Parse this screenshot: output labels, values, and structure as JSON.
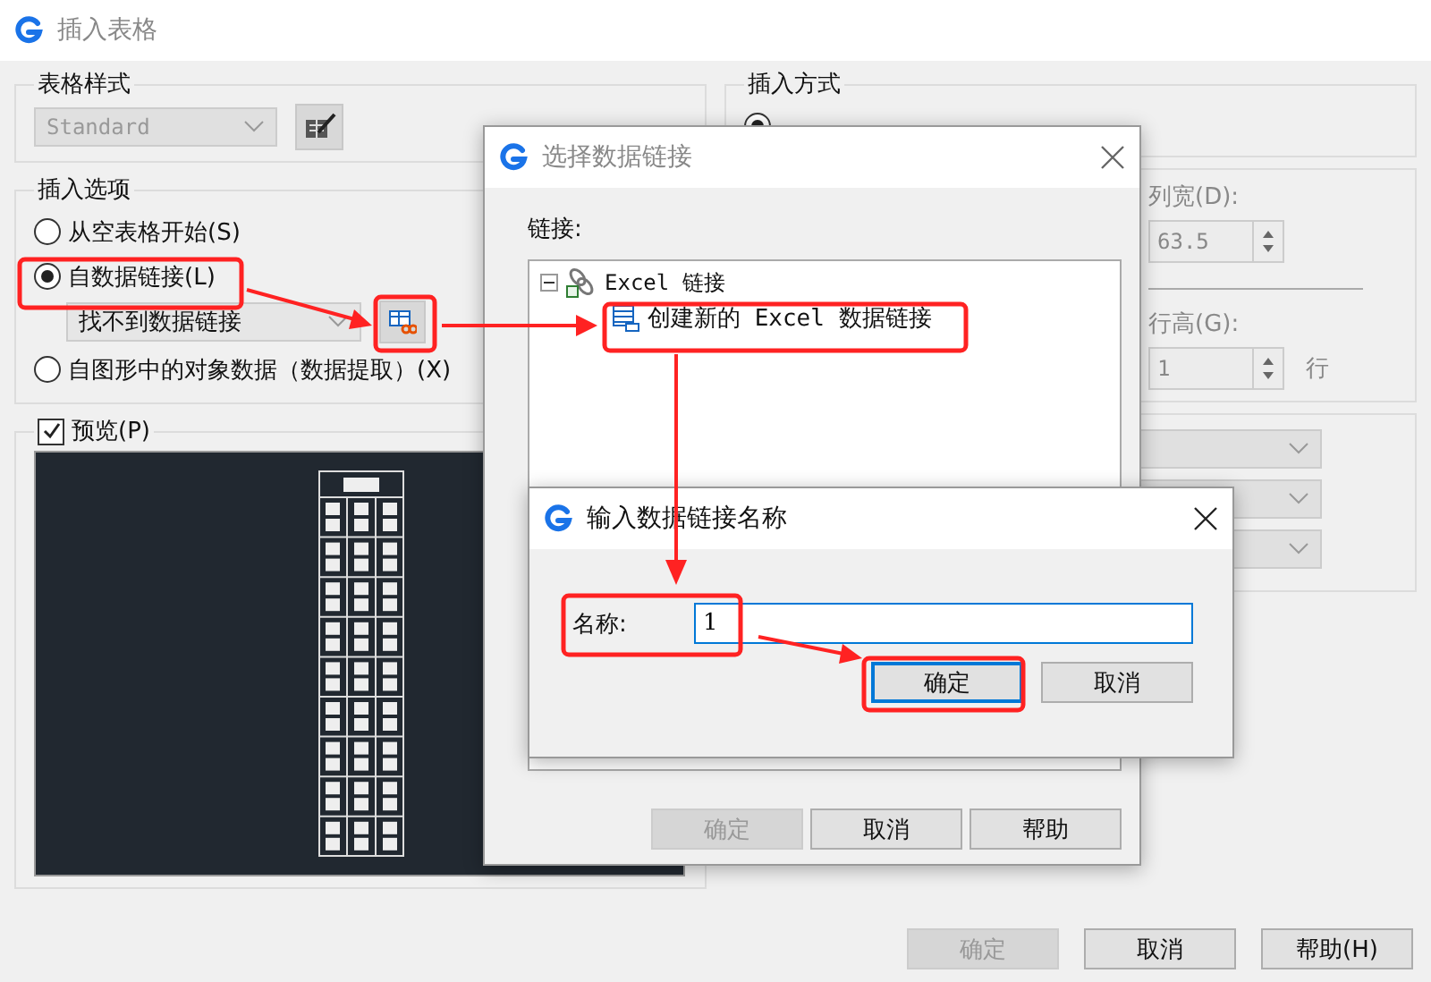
{
  "main_window": {
    "title": "插入表格",
    "table_style": {
      "label": "表格样式",
      "value": "Standard",
      "disabled": true
    },
    "insert_options": {
      "label": "插入选项",
      "options": [
        {
          "label": "从空表格开始(S)",
          "selected": false
        },
        {
          "label": "自数据链接(L)",
          "selected": true
        },
        {
          "label": "自图形中的对象数据（数据提取）(X)",
          "selected": false
        }
      ],
      "link_value": "找不到数据链接"
    },
    "preview": {
      "label": "预览(P)",
      "checked": true
    },
    "insert_method": {
      "label": "插入方式",
      "option": {
        "selected": true
      }
    },
    "column_width": {
      "label": "列宽(D):",
      "value": "63.5"
    },
    "row_height": {
      "label": "行高(G):",
      "value": "1",
      "unit": "行"
    },
    "buttons": [
      {
        "label": "确定",
        "disabled": true
      },
      {
        "label": "取消",
        "disabled": false
      },
      {
        "label": "帮助(H)",
        "disabled": false
      }
    ]
  },
  "link_dialog": {
    "title": "选择数据链接",
    "tree_label": "链接:",
    "tree": [
      {
        "label": "Excel 链接",
        "expanded": true,
        "children": [
          {
            "label": "创建新的 Excel 数据链接"
          }
        ]
      }
    ],
    "buttons": [
      {
        "label": "确定",
        "disabled": true
      },
      {
        "label": "取消",
        "disabled": false
      },
      {
        "label": "帮助",
        "disabled": false
      }
    ]
  },
  "name_dialog": {
    "title": "输入数据链接名称",
    "field_label": "名称:",
    "value": "1",
    "buttons": [
      {
        "label": "确定",
        "focused": true
      },
      {
        "label": "取消",
        "focused": false
      }
    ]
  }
}
